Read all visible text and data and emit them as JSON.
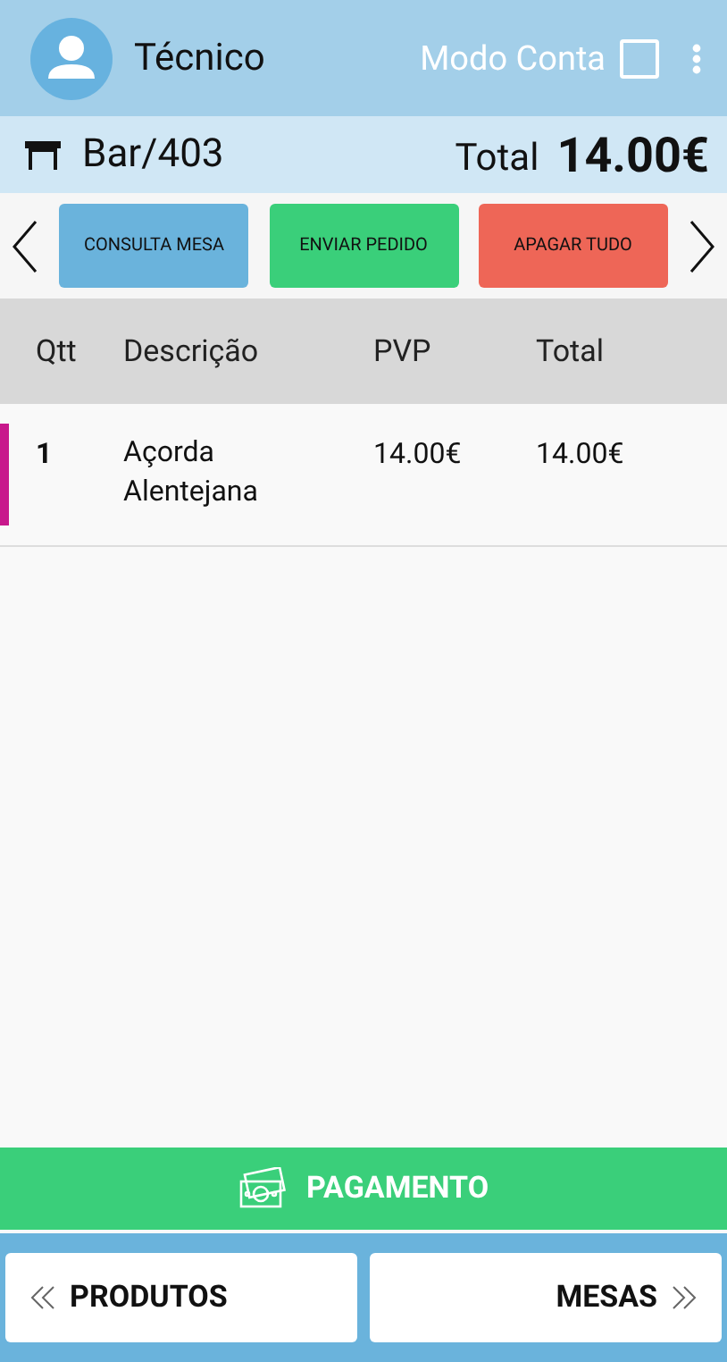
{
  "header": {
    "user": "Técnico",
    "mode_label": "Modo Conta",
    "mode_checked": false
  },
  "table_info": {
    "name": "Bar/403",
    "total_label": "Total",
    "total": "14.00€"
  },
  "actions": [
    {
      "label": "CONSULTA MESA",
      "color": "#6ab3dc"
    },
    {
      "label": "ENVIAR PEDIDO",
      "color": "#3acf7a"
    },
    {
      "label": "APAGAR TUDO",
      "color": "#ee6657"
    }
  ],
  "table": {
    "columns": [
      "Qtt",
      "Descrição",
      "PVP",
      "Total"
    ],
    "rows": [
      {
        "qtt": "1",
        "description": "Açorda Alentejana",
        "pvp": "14.00€",
        "total": "14.00€",
        "color": "#c8188c"
      }
    ]
  },
  "payment_button": "PAGAMENTO",
  "nav": {
    "back": "PRODUTOS",
    "forward": "MESAS"
  }
}
